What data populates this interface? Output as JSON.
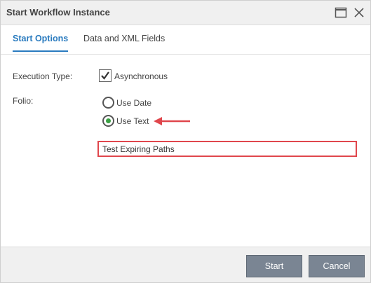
{
  "window": {
    "title": "Start Workflow Instance"
  },
  "tabs": [
    {
      "label": "Start Options",
      "active": true
    },
    {
      "label": "Data and XML Fields",
      "active": false
    }
  ],
  "form": {
    "execution_type_label": "Execution Type:",
    "asynchronous_label": "Asynchronous",
    "asynchronous_checked": true,
    "folio_label": "Folio:",
    "folio_options": [
      {
        "label": "Use Date",
        "selected": false
      },
      {
        "label": "Use Text",
        "selected": true
      }
    ],
    "folio_text_value": "Test Expiring Paths"
  },
  "buttons": {
    "start_label": "Start",
    "cancel_label": "Cancel"
  },
  "colors": {
    "accent": "#2a7bbf",
    "radio_selected": "#3aa043",
    "highlight": "#e0464c",
    "button_bg": "#7a8593"
  }
}
